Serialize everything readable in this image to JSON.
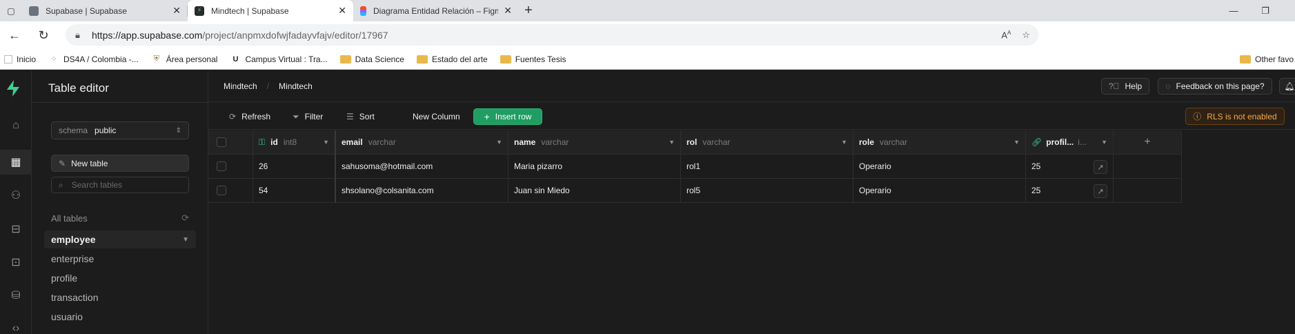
{
  "browser": {
    "tabs": [
      {
        "title": "Supabase | Supabase",
        "favicon_color": "#6b7280"
      },
      {
        "title": "Mindtech | Supabase",
        "favicon_color": "#2a2a2a"
      },
      {
        "title": "Diagrama Entidad Relación – Figma",
        "favicon_color": "#f24e1e"
      }
    ],
    "url": {
      "domain": "https://app.supabase.com",
      "path": "/project/anpmxdofwjfadayvfajv/editor/17967"
    },
    "bookmarks": [
      {
        "label": "Inicio",
        "type": "page"
      },
      {
        "label": "DS4A / Colombia -...",
        "type": "page"
      },
      {
        "label": "Área personal",
        "type": "page"
      },
      {
        "label": "Campus Virtual : Tra...",
        "type": "page"
      },
      {
        "label": "Data Science",
        "type": "folder"
      },
      {
        "label": "Estado del arte",
        "type": "folder"
      },
      {
        "label": "Fuentes Tesis",
        "type": "folder"
      }
    ],
    "other_bookmarks": "Other favo"
  },
  "sidebar": {
    "title": "Table editor",
    "schema_label": "schema",
    "schema_value": "public",
    "new_table_label": "New table",
    "search_placeholder": "Search tables",
    "all_tables_label": "All tables",
    "tables": [
      "employee",
      "enterprise",
      "profile",
      "transaction",
      "usuario"
    ],
    "active_table": "employee"
  },
  "topnav": {
    "breadcrumb": [
      "Mindtech",
      "Mindtech"
    ],
    "help_label": "Help",
    "feedback_label": "Feedback on this page?"
  },
  "toolbar": {
    "refresh_label": "Refresh",
    "filter_label": "Filter",
    "sort_label": "Sort",
    "new_column_label": "New Column",
    "insert_row_label": "Insert row",
    "rls_label": "RLS is not enabled"
  },
  "grid": {
    "columns": [
      {
        "name": "id",
        "type": "int8"
      },
      {
        "name": "email",
        "type": "varchar"
      },
      {
        "name": "name",
        "type": "varchar"
      },
      {
        "name": "rol",
        "type": "varchar"
      },
      {
        "name": "role",
        "type": "varchar"
      },
      {
        "name": "profil...",
        "type": "i..."
      }
    ],
    "rows": [
      [
        "26",
        "sahusoma@hotmail.com",
        "Maria pizarro",
        "rol1",
        "Operario",
        "25"
      ],
      [
        "54",
        "shsolano@colsanita.com",
        "Juan sin Miedo",
        "rol5",
        "Operario",
        "25"
      ]
    ]
  },
  "colors": {
    "accent": "#3ecf8e",
    "insert_button": "#1f9d62",
    "warning": "#f5a94b",
    "background": "#1c1c1c"
  }
}
